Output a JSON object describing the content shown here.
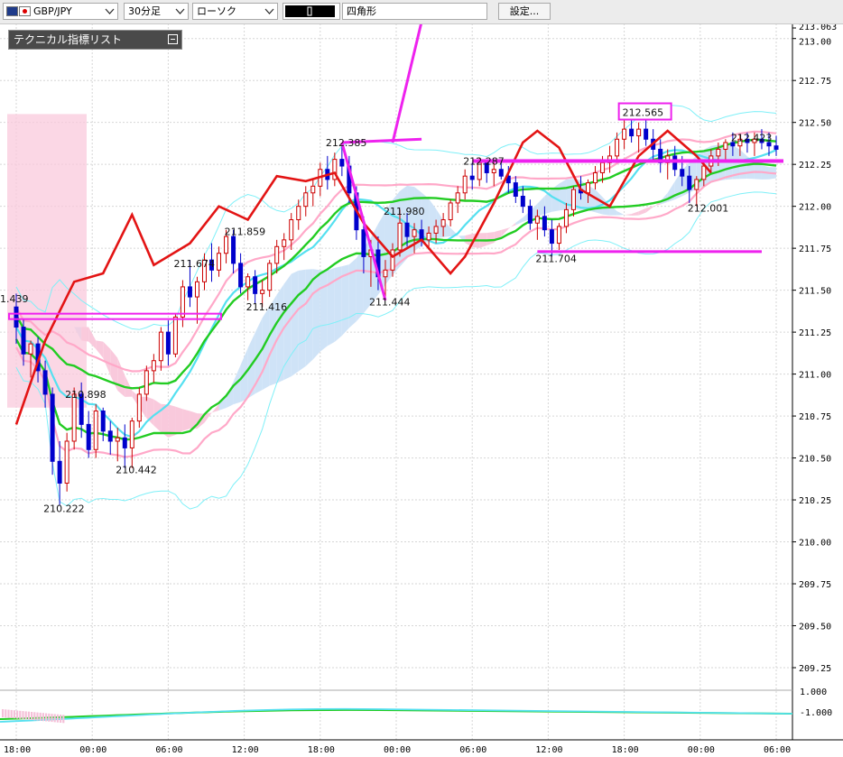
{
  "toolbar": {
    "symbol": "GBP/JPY",
    "timeframe": "30分足",
    "chart_type": "ローソク",
    "drawing_tool": "四角形",
    "settings_label": "設定..."
  },
  "tech_list": {
    "label": "テクニカル指標リスト"
  },
  "colors": {
    "candle_up": "#cc0000",
    "candle_down": "#0000cc",
    "rsi_line": "#e31414",
    "ma_short": "#55e0f0",
    "ma_mid": "#22cc22",
    "bb_sigma1": "#ffa8c8",
    "bb_sigma2": "#7ff0f8",
    "kumo_bull": "#cfe3f7",
    "kumo_bear": "#f9c9dc",
    "annotation": "#ee22ee"
  },
  "chart_data": {
    "type": "candlestick",
    "symbol": "GBP/JPY",
    "interval": "30分足",
    "ylim": [
      209.0,
      213.063
    ],
    "y_ticks": [
      "213.063",
      "213.00",
      "212.75",
      "212.50",
      "212.25",
      "212.00",
      "211.75",
      "211.50",
      "211.25",
      "211.00",
      "210.75",
      "210.50",
      "210.25",
      "210.00",
      "209.75",
      "209.50",
      "209.25"
    ],
    "x_ticks": [
      "18:00",
      "00:00",
      "06:00",
      "12:00",
      "18:00",
      "00:00",
      "06:00",
      "12:00",
      "18:00",
      "00:00",
      "06:00"
    ],
    "price_labels": [
      {
        "text": "1.439",
        "index": 0,
        "price": 211.45
      },
      {
        "text": "210.898",
        "index": 9,
        "price": 210.88
      },
      {
        "text": "210.222",
        "index": 6,
        "price": 210.2
      },
      {
        "text": "210.442",
        "index": 16,
        "price": 210.43
      },
      {
        "text": "211.674",
        "index": 24,
        "price": 211.66
      },
      {
        "text": "211.859",
        "index": 31,
        "price": 211.85
      },
      {
        "text": "211.416",
        "index": 34,
        "price": 211.4
      },
      {
        "text": "212.385",
        "index": 45,
        "price": 212.38
      },
      {
        "text": "211.980",
        "index": 53,
        "price": 211.97
      },
      {
        "text": "211.444",
        "index": 51,
        "price": 211.43
      },
      {
        "text": "212.287",
        "index": 64,
        "price": 212.27
      },
      {
        "text": "211.704",
        "index": 74,
        "price": 211.69
      },
      {
        "text": "212.565",
        "index": 86,
        "price": 212.56
      },
      {
        "text": "212.001",
        "index": 95,
        "price": 211.99
      },
      {
        "text": "212.423",
        "index": 101,
        "price": 212.41
      }
    ],
    "osc_labels": [
      "1.000",
      "-1.000"
    ],
    "candles": [
      [
        211.4,
        211.48,
        211.18,
        211.28
      ],
      [
        211.28,
        211.33,
        211.05,
        211.12
      ],
      [
        211.12,
        211.2,
        210.98,
        211.18
      ],
      [
        211.18,
        211.22,
        210.95,
        211.02
      ],
      [
        211.02,
        211.08,
        210.8,
        210.88
      ],
      [
        210.88,
        210.92,
        210.4,
        210.48
      ],
      [
        210.48,
        210.6,
        210.22,
        210.35
      ],
      [
        210.35,
        210.65,
        210.3,
        210.6
      ],
      [
        210.6,
        210.92,
        210.55,
        210.88
      ],
      [
        210.88,
        210.95,
        210.62,
        210.7
      ],
      [
        210.7,
        210.78,
        210.5,
        210.55
      ],
      [
        210.55,
        210.82,
        210.5,
        210.78
      ],
      [
        210.78,
        210.8,
        210.6,
        210.66
      ],
      [
        210.66,
        210.72,
        210.52,
        210.6
      ],
      [
        210.6,
        210.68,
        210.48,
        210.62
      ],
      [
        210.62,
        210.7,
        210.44,
        210.56
      ],
      [
        210.56,
        210.74,
        210.44,
        210.72
      ],
      [
        210.72,
        210.92,
        210.68,
        210.88
      ],
      [
        210.88,
        211.05,
        210.84,
        211.02
      ],
      [
        211.02,
        211.12,
        210.95,
        211.08
      ],
      [
        211.08,
        211.28,
        211.02,
        211.25
      ],
      [
        211.25,
        211.32,
        211.05,
        211.12
      ],
      [
        211.12,
        211.36,
        211.1,
        211.34
      ],
      [
        211.34,
        211.56,
        211.28,
        211.52
      ],
      [
        211.52,
        211.68,
        211.4,
        211.46
      ],
      [
        211.46,
        211.58,
        211.3,
        211.55
      ],
      [
        211.55,
        211.72,
        211.5,
        211.68
      ],
      [
        211.68,
        211.78,
        211.55,
        211.62
      ],
      [
        211.62,
        211.76,
        211.58,
        211.72
      ],
      [
        211.72,
        211.86,
        211.66,
        211.82
      ],
      [
        211.82,
        211.86,
        211.6,
        211.66
      ],
      [
        211.66,
        211.72,
        211.48,
        211.52
      ],
      [
        211.52,
        211.6,
        211.44,
        211.58
      ],
      [
        211.58,
        211.62,
        211.42,
        211.48
      ],
      [
        211.48,
        211.56,
        211.4,
        211.5
      ],
      [
        211.5,
        211.68,
        211.46,
        211.66
      ],
      [
        211.66,
        211.8,
        211.6,
        211.76
      ],
      [
        211.76,
        211.84,
        211.68,
        211.8
      ],
      [
        211.8,
        211.96,
        211.74,
        211.92
      ],
      [
        211.92,
        212.04,
        211.86,
        212.0
      ],
      [
        212.0,
        212.12,
        211.94,
        212.08
      ],
      [
        212.08,
        212.16,
        212.0,
        212.12
      ],
      [
        212.12,
        212.26,
        212.06,
        212.22
      ],
      [
        212.22,
        212.3,
        212.1,
        212.16
      ],
      [
        212.16,
        212.32,
        212.12,
        212.28
      ],
      [
        212.28,
        212.38,
        212.18,
        212.24
      ],
      [
        212.24,
        212.3,
        212.02,
        212.08
      ],
      [
        212.08,
        212.12,
        211.8,
        211.86
      ],
      [
        211.86,
        211.94,
        211.6,
        211.7
      ],
      [
        211.7,
        211.8,
        211.52,
        211.74
      ],
      [
        211.74,
        211.82,
        211.5,
        211.58
      ],
      [
        211.58,
        211.68,
        211.44,
        211.62
      ],
      [
        211.62,
        211.78,
        211.58,
        211.74
      ],
      [
        211.74,
        211.98,
        211.7,
        211.9
      ],
      [
        211.9,
        211.96,
        211.76,
        211.82
      ],
      [
        211.82,
        211.9,
        211.72,
        211.86
      ],
      [
        211.86,
        211.92,
        211.76,
        211.8
      ],
      [
        211.8,
        211.88,
        211.74,
        211.84
      ],
      [
        211.84,
        211.92,
        211.78,
        211.88
      ],
      [
        211.88,
        211.96,
        211.82,
        211.92
      ],
      [
        211.92,
        212.04,
        211.88,
        212.02
      ],
      [
        212.02,
        212.12,
        211.96,
        212.08
      ],
      [
        212.08,
        212.22,
        212.04,
        212.18
      ],
      [
        212.18,
        212.26,
        212.1,
        212.16
      ],
      [
        212.16,
        212.29,
        212.12,
        212.26
      ],
      [
        212.26,
        212.28,
        212.14,
        212.2
      ],
      [
        212.2,
        212.26,
        212.12,
        212.22
      ],
      [
        212.22,
        212.28,
        212.16,
        212.18
      ],
      [
        212.18,
        212.24,
        212.08,
        212.14
      ],
      [
        212.14,
        212.18,
        212.02,
        212.06
      ],
      [
        212.06,
        212.12,
        211.96,
        212.0
      ],
      [
        212.0,
        212.04,
        211.86,
        211.9
      ],
      [
        211.9,
        211.98,
        211.8,
        211.94
      ],
      [
        211.94,
        212.0,
        211.82,
        211.86
      ],
      [
        211.86,
        211.92,
        211.7,
        211.78
      ],
      [
        211.78,
        211.9,
        211.74,
        211.88
      ],
      [
        211.88,
        212.02,
        211.84,
        211.98
      ],
      [
        211.98,
        212.12,
        211.94,
        212.1
      ],
      [
        212.1,
        212.18,
        212.04,
        212.08
      ],
      [
        212.08,
        212.16,
        212.02,
        212.14
      ],
      [
        212.14,
        212.24,
        212.1,
        212.2
      ],
      [
        212.2,
        212.3,
        212.14,
        212.26
      ],
      [
        212.26,
        212.36,
        212.2,
        212.3
      ],
      [
        212.3,
        212.44,
        212.26,
        212.4
      ],
      [
        212.4,
        212.52,
        212.34,
        212.46
      ],
      [
        212.46,
        212.56,
        212.38,
        212.42
      ],
      [
        212.42,
        212.5,
        212.32,
        212.46
      ],
      [
        212.46,
        212.52,
        212.36,
        212.4
      ],
      [
        212.4,
        212.46,
        212.28,
        212.34
      ],
      [
        212.34,
        212.4,
        212.2,
        212.26
      ],
      [
        212.26,
        212.34,
        212.16,
        212.3
      ],
      [
        212.3,
        212.36,
        212.18,
        212.22
      ],
      [
        212.22,
        212.3,
        212.12,
        212.18
      ],
      [
        212.18,
        212.24,
        212.02,
        212.1
      ],
      [
        212.1,
        212.18,
        212.0,
        212.16
      ],
      [
        212.16,
        212.26,
        212.12,
        212.24
      ],
      [
        212.24,
        212.34,
        212.2,
        212.3
      ],
      [
        212.3,
        212.38,
        212.24,
        212.34
      ],
      [
        212.34,
        212.4,
        212.26,
        212.38
      ],
      [
        212.38,
        212.44,
        212.3,
        212.36
      ],
      [
        212.36,
        212.43,
        212.3,
        212.4
      ],
      [
        212.4,
        212.44,
        212.32,
        212.38
      ],
      [
        212.38,
        212.44,
        212.3,
        212.4
      ],
      [
        212.4,
        212.46,
        212.34,
        212.38
      ],
      [
        212.38,
        212.44,
        212.3,
        212.36
      ],
      [
        212.36,
        212.42,
        212.3,
        212.34
      ]
    ],
    "rsi_line": [
      [
        0,
        210.7
      ],
      [
        4,
        211.2
      ],
      [
        8,
        211.55
      ],
      [
        12,
        211.6
      ],
      [
        16,
        211.95
      ],
      [
        19,
        211.65
      ],
      [
        24,
        211.78
      ],
      [
        28,
        212.0
      ],
      [
        32,
        211.92
      ],
      [
        36,
        212.18
      ],
      [
        40,
        212.15
      ],
      [
        44,
        212.2
      ],
      [
        48,
        211.9
      ],
      [
        52,
        211.7
      ],
      [
        56,
        211.8
      ],
      [
        60,
        211.6
      ],
      [
        62,
        211.7
      ],
      [
        66,
        212.02
      ],
      [
        70,
        212.38
      ],
      [
        72,
        212.45
      ],
      [
        75,
        212.35
      ],
      [
        78,
        212.1
      ],
      [
        82,
        212.0
      ],
      [
        86,
        212.3
      ],
      [
        90,
        212.45
      ],
      [
        94,
        212.3
      ],
      [
        96,
        212.2
      ]
    ]
  }
}
